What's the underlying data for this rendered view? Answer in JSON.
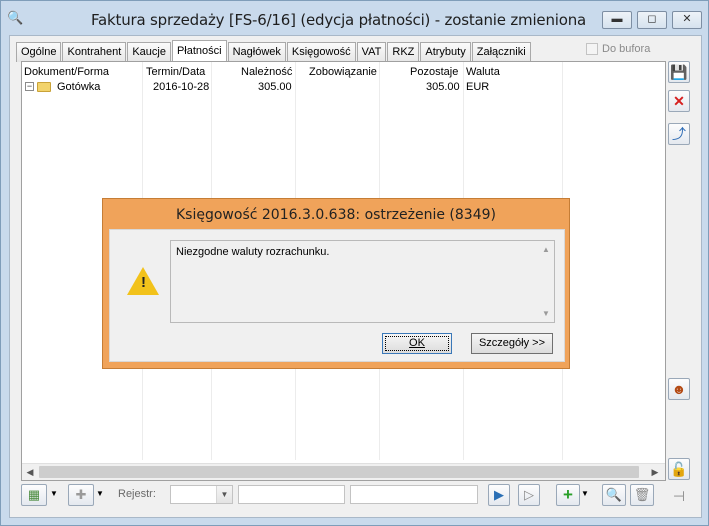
{
  "window": {
    "title": "Faktura sprzedaży [FS-6/16] (edycja płatności) - zostanie zmieniona",
    "app_icon": "magnifier-icon",
    "controls": {
      "minimize": "▭",
      "maximize": "◻",
      "close": "✕"
    }
  },
  "tabs": [
    {
      "label": "Ogólne",
      "active": false
    },
    {
      "label": "Kontrahent",
      "active": false
    },
    {
      "label": "Kaucje",
      "active": false
    },
    {
      "label": "Płatności",
      "active": true
    },
    {
      "label": "Nagłówek",
      "active": false
    },
    {
      "label": "Księgowość",
      "active": false
    },
    {
      "label": "VAT",
      "active": false
    },
    {
      "label": "RKZ",
      "active": false
    },
    {
      "label": "Atrybuty",
      "active": false
    },
    {
      "label": "Załączniki",
      "active": false
    }
  ],
  "do_bufora": {
    "label": "Do bufora",
    "checked": false
  },
  "table": {
    "columns": [
      "Dokument/Forma",
      "Termin/Data",
      "Należność",
      "Zobowiązanie",
      "Pozostaje",
      "Waluta"
    ],
    "rows": [
      {
        "dokument": "Gotówka",
        "termin": "2016-10-28",
        "naleznosc": "305.00",
        "zobowiazanie": "",
        "pozostaje": "305.00",
        "waluta": "EUR"
      }
    ]
  },
  "bottom": {
    "rejestr_label": "Rejestr:"
  },
  "dialog": {
    "title": "Księgowość 2016.3.0.638: ostrzeżenie (8349)",
    "message": "Niezgodne waluty rozrachunku.",
    "ok_label": "OK",
    "details_label": "Szczegóły >>"
  },
  "icons": {
    "save": "save-icon",
    "cancel": "cancel-icon",
    "export": "export-icon",
    "person": "person-icon",
    "lock": "lock-icon",
    "pin": "pin-icon",
    "warning": "warning-icon"
  },
  "colors": {
    "dialog_accent": "#f0a35a",
    "warning_yellow": "#f2c21b",
    "title_bar": "#c9daec"
  }
}
